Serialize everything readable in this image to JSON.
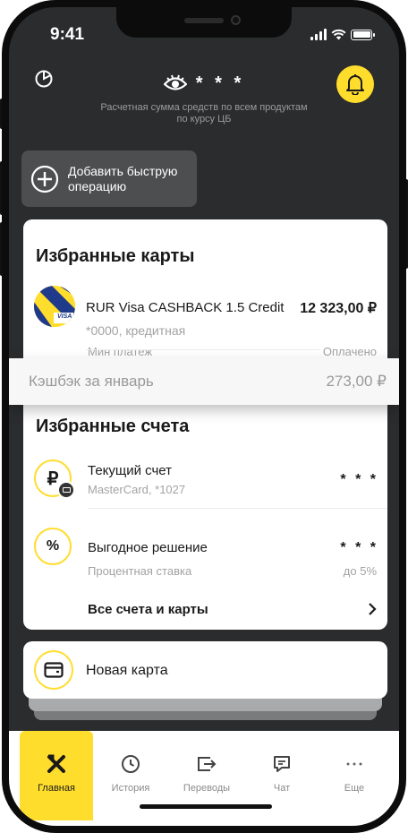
{
  "status_bar": {
    "time": "9:41"
  },
  "header": {
    "balance_masked": "* * *",
    "balance_caption": "Расчетная сумма средств по всем продуктам по курсу ЦБ"
  },
  "quick_operation": {
    "label": "Добавить быструю операцию"
  },
  "favorite_cards": {
    "title": "Избранные карты",
    "card": {
      "name": "RUR Visa CASHBACK 1.5 Credit",
      "amount": "12 323,00 ₽",
      "number": "*0000, кредитная",
      "min_payment_label": "Мин платеж",
      "min_payment_status": "Оплачено",
      "brand": "VISA"
    }
  },
  "cashback": {
    "label": "Кэшбэк за январь",
    "amount": "273,00 ₽"
  },
  "favorite_accounts": {
    "title": "Избранные счета",
    "items": [
      {
        "name": "Текущий счет",
        "sub": "MasterCard, *1027",
        "value": "* * *",
        "icon": "ruble-icon"
      },
      {
        "name": "Выгодное решение",
        "sub": "Процентная ставка",
        "value": "* * *",
        "extra": "до 5%",
        "icon": "percent-icon"
      }
    ],
    "all_link": "Все счета и карты"
  },
  "new_card": {
    "label": "Новая карта"
  },
  "tabbar": {
    "tabs": [
      {
        "label": "Главная",
        "icon": "home-logo-icon",
        "active": true
      },
      {
        "label": "История",
        "icon": "clock-icon"
      },
      {
        "label": "Переводы",
        "icon": "transfer-icon"
      },
      {
        "label": "Чат",
        "icon": "chat-icon"
      },
      {
        "label": "Еще",
        "icon": "more-icon"
      }
    ]
  },
  "colors": {
    "accent": "#ffdd2d",
    "background": "#2b2c2e",
    "panel": "#ffffff"
  }
}
